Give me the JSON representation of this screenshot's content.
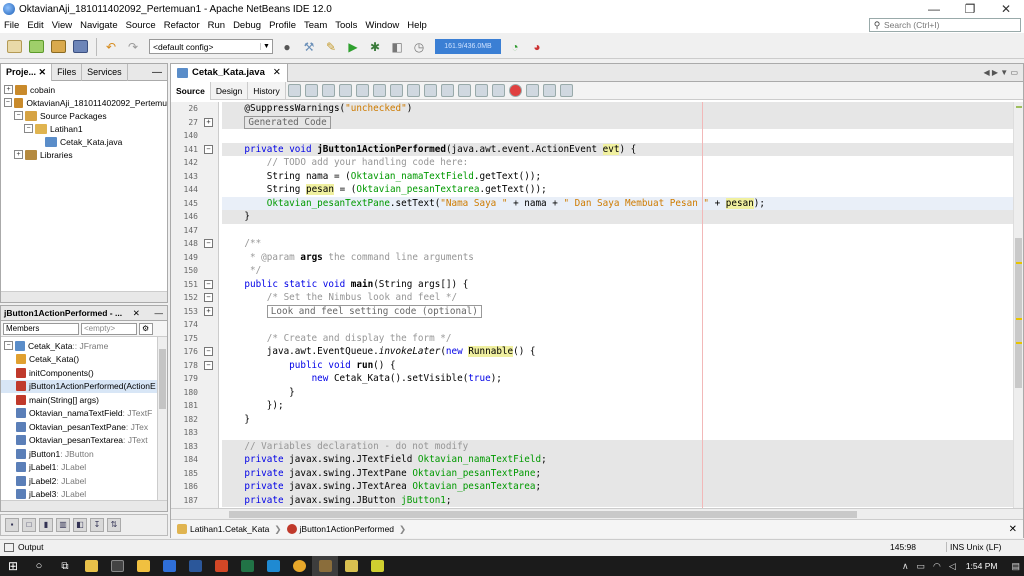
{
  "window": {
    "title": "OktavianAji_181011402092_Pertemuan1 - Apache NetBeans IDE 12.0"
  },
  "menu": [
    "File",
    "Edit",
    "View",
    "Navigate",
    "Source",
    "Refactor",
    "Run",
    "Debug",
    "Profile",
    "Team",
    "Tools",
    "Window",
    "Help"
  ],
  "search": {
    "placeholder": "Search (Ctrl+I)"
  },
  "toolbar": {
    "config": "<default config>",
    "memory": "161.9/436.0MB"
  },
  "projects_panel": {
    "tabs": [
      "Proje...",
      "Files",
      "Services"
    ],
    "tree": [
      {
        "label": "cobain",
        "indent": 0,
        "exp": "+",
        "icon": "#c98a2b"
      },
      {
        "label": "OktavianAji_181011402092_Pertemu",
        "indent": 0,
        "exp": "−",
        "icon": "#c98a2b"
      },
      {
        "label": "Source Packages",
        "indent": 1,
        "exp": "−",
        "icon": "#d6a343"
      },
      {
        "label": "Latihan1",
        "indent": 2,
        "exp": "−",
        "icon": "#e0b450"
      },
      {
        "label": "Cetak_Kata.java",
        "indent": 3,
        "exp": "",
        "icon": "#5a8dc9"
      },
      {
        "label": "Libraries",
        "indent": 1,
        "exp": "+",
        "icon": "#b58a3f"
      }
    ]
  },
  "navigator": {
    "title": "jButton1ActionPerformed - ...",
    "filter": "Members",
    "filter2": "<empty>",
    "items": [
      {
        "label": "Cetak_Kata",
        "type": " :: JFrame",
        "indent": 0,
        "icon": "#5a8dc9"
      },
      {
        "label": "Cetak_Kata()",
        "type": "",
        "indent": 1,
        "icon": "#e0a030"
      },
      {
        "label": "initComponents()",
        "type": "",
        "indent": 1,
        "icon": "#c0392b"
      },
      {
        "label": "jButton1ActionPerformed(ActionE",
        "type": "",
        "indent": 1,
        "icon": "#c0392b",
        "selected": true
      },
      {
        "label": "main(String[] args)",
        "type": "",
        "indent": 1,
        "icon": "#c0392b"
      },
      {
        "label": "Oktavian_namaTextField",
        "type": " : JTextF",
        "indent": 1,
        "icon": "#5b7fb8"
      },
      {
        "label": "Oktavian_pesanTextPane",
        "type": " : JTex",
        "indent": 1,
        "icon": "#5b7fb8"
      },
      {
        "label": "Oktavian_pesanTextarea",
        "type": " : JText",
        "indent": 1,
        "icon": "#5b7fb8"
      },
      {
        "label": "jButton1",
        "type": " : JButton",
        "indent": 1,
        "icon": "#5b7fb8"
      },
      {
        "label": "jLabel1",
        "type": " : JLabel",
        "indent": 1,
        "icon": "#5b7fb8"
      },
      {
        "label": "jLabel2",
        "type": " : JLabel",
        "indent": 1,
        "icon": "#5b7fb8"
      },
      {
        "label": "jLabel3",
        "type": " : JLabel",
        "indent": 1,
        "icon": "#5b7fb8"
      }
    ]
  },
  "editor": {
    "tab": "Cetak_Kata.java",
    "views": [
      "Source",
      "Design",
      "History"
    ],
    "lines": [
      {
        "n": "26",
        "fold": "",
        "cls": "grey",
        "html": "    @SuppressWarnings(<span class='st'>\"unchecked\"</span>)"
      },
      {
        "n": "27",
        "fold": "+",
        "cls": "grey",
        "html": "    <span class='collapsed'>Generated Code</span>"
      },
      {
        "n": "140",
        "fold": "",
        "cls": "",
        "html": ""
      },
      {
        "n": "141",
        "fold": "−",
        "cls": "grey",
        "html": "    <span class='kw'>private</span> <span class='kw'>void</span> <span class='b'>jButton1ActionPerformed</span>(java.awt.event.ActionEvent <span class='hl'>evt</span>) {"
      },
      {
        "n": "142",
        "fold": "",
        "cls": "",
        "html": "        <span class='cm'>// TODO add your handling code here:</span>"
      },
      {
        "n": "143",
        "fold": "",
        "cls": "",
        "html": "        String nama = (<span class='fld'>Oktavian_namaTextField</span>.getText());"
      },
      {
        "n": "144",
        "fold": "",
        "cls": "",
        "html": "        String <span class='hl'>pesan</span> = (<span class='fld'>Oktavian_pesanTextarea</span>.getText());"
      },
      {
        "n": "145",
        "fold": "",
        "cls": "cur",
        "html": "        <span class='fld'>Oktavian_pesanTextPane</span>.setText(<span class='st'>\"Nama Saya \"</span> + nama + <span class='st'>\" Dan Saya Membuat Pesan \"</span> + <span class='hl'>pesan</span>);"
      },
      {
        "n": "146",
        "fold": "",
        "cls": "grey",
        "html": "    }"
      },
      {
        "n": "147",
        "fold": "",
        "cls": "",
        "html": ""
      },
      {
        "n": "148",
        "fold": "−",
        "cls": "",
        "html": "    <span class='cm'>/**</span>"
      },
      {
        "n": "149",
        "fold": "",
        "cls": "",
        "html": "<span class='cm'>     * @param </span><span class='b'>args</span><span class='cm'> the command line arguments</span>"
      },
      {
        "n": "150",
        "fold": "",
        "cls": "",
        "html": "     <span class='cm'>*/</span>"
      },
      {
        "n": "151",
        "fold": "−",
        "cls": "",
        "html": "    <span class='kw'>public</span> <span class='kw'>static</span> <span class='kw'>void</span> <span class='b'>main</span>(String args[]) {"
      },
      {
        "n": "152",
        "fold": "−",
        "cls": "",
        "html": "        <span class='cm'>/* Set the Nimbus look and feel */</span>"
      },
      {
        "n": "153",
        "fold": "+",
        "cls": "",
        "html": "        <span class='collapsed'>Look and feel setting code (optional)</span>"
      },
      {
        "n": "174",
        "fold": "",
        "cls": "",
        "html": ""
      },
      {
        "n": "175",
        "fold": "",
        "cls": "",
        "html": "        <span class='cm'>/* Create and display the form */</span>"
      },
      {
        "n": "176",
        "fold": "−",
        "cls": "",
        "html": "        java.awt.EventQueue.<span class='it'>invokeLater</span>(<span class='kw'>new</span> <span class='hl'>Runnable</span>() {"
      },
      {
        "n": "178",
        "fold": "−",
        "cls": "",
        "html": "            <span class='kw'>public</span> <span class='kw'>void</span> <span class='b'>run</span>() {"
      },
      {
        "n": "179",
        "fold": "",
        "cls": "",
        "html": "                <span class='kw'>new</span> Cetak_Kata().setVisible(<span class='kw'>true</span>);"
      },
      {
        "n": "180",
        "fold": "",
        "cls": "",
        "html": "            }"
      },
      {
        "n": "181",
        "fold": "",
        "cls": "",
        "html": "        });"
      },
      {
        "n": "182",
        "fold": "",
        "cls": "",
        "html": "    }"
      },
      {
        "n": "183",
        "fold": "",
        "cls": "",
        "html": ""
      },
      {
        "n": "183",
        "fold": "",
        "cls": "grey",
        "html": "    <span class='cm'>// Variables declaration - do not modify</span>"
      },
      {
        "n": "184",
        "fold": "",
        "cls": "grey",
        "html": "    <span class='kw'>private</span> javax.swing.JTextField <span class='fld'>Oktavian_namaTextField</span>;"
      },
      {
        "n": "185",
        "fold": "",
        "cls": "grey",
        "html": "    <span class='kw'>private</span> javax.swing.JTextPane <span class='fld'>Oktavian_pesanTextPane</span>;"
      },
      {
        "n": "186",
        "fold": "",
        "cls": "grey",
        "html": "    <span class='kw'>private</span> javax.swing.JTextArea <span class='fld'>Oktavian_pesanTextarea</span>;"
      },
      {
        "n": "187",
        "fold": "",
        "cls": "grey",
        "html": "    <span class='kw'>private</span> javax.swing.JButton <span class='fld'>jButton1</span>;"
      }
    ]
  },
  "breadcrumb": [
    "Latihan1.Cetak_Kata",
    "jButton1ActionPerformed"
  ],
  "status": {
    "output": "Output",
    "position": "145:98",
    "mode": "INS Unix (LF)"
  },
  "taskbar": {
    "time": "1:54 PM"
  }
}
